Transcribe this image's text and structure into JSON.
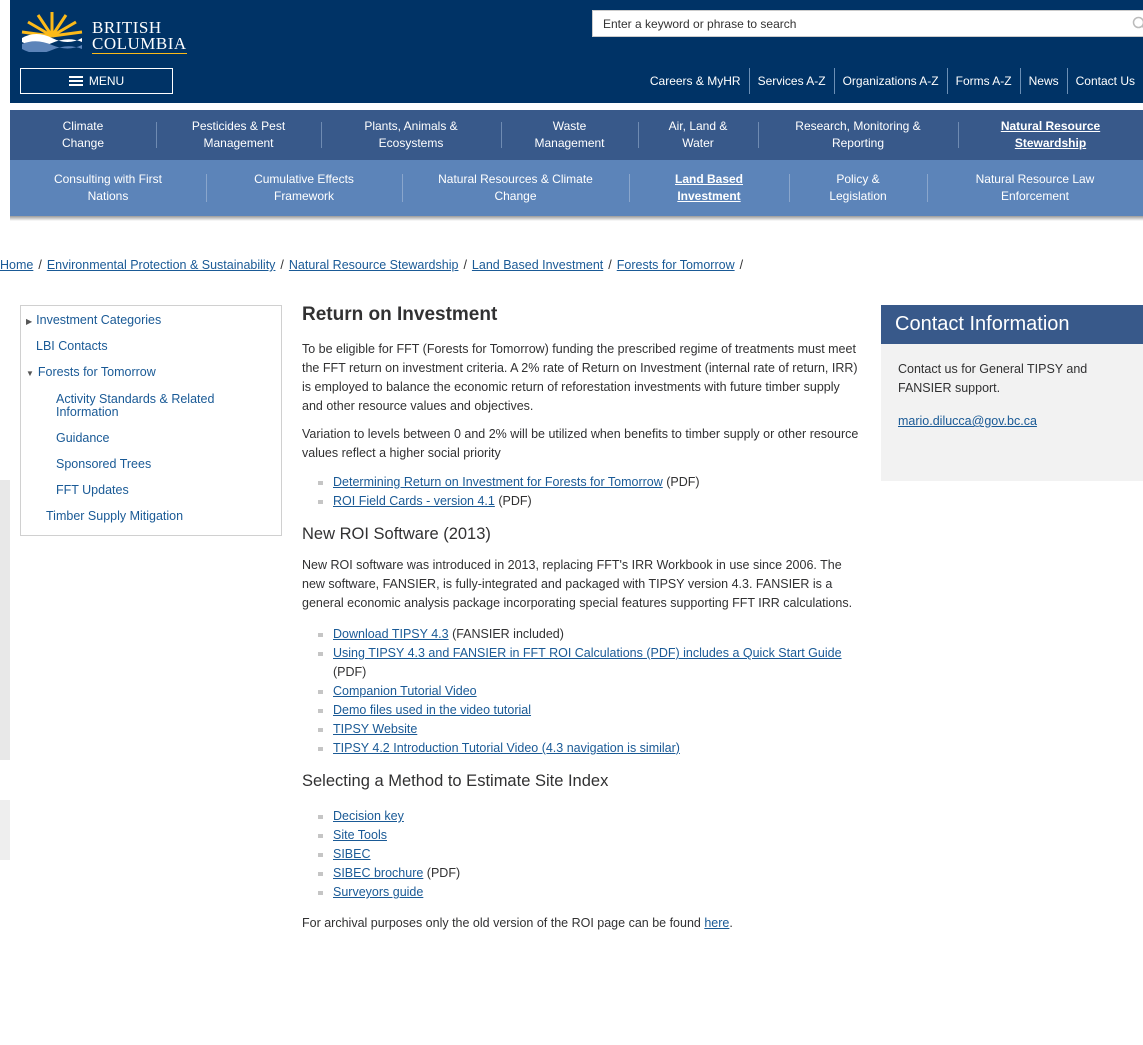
{
  "header": {
    "logo_line1": "BRITISH",
    "logo_line2": "COLUMBIA",
    "search_placeholder": "Enter a keyword or phrase to search",
    "menu_label": "MENU",
    "top_links": [
      "Careers & MyHR",
      "Services A-Z",
      "Organizations A-Z",
      "Forms A-Z",
      "News",
      "Contact Us"
    ]
  },
  "nav_primary": [
    {
      "l1": "Climate",
      "l2": "Change"
    },
    {
      "l1": "Pesticides & Pest",
      "l2": "Management"
    },
    {
      "l1": "Plants, Animals &",
      "l2": "Ecosystems"
    },
    {
      "l1": "Waste",
      "l2": "Management"
    },
    {
      "l1": "Air, Land &",
      "l2": "Water"
    },
    {
      "l1": "Research, Monitoring &",
      "l2": "Reporting"
    },
    {
      "l1": "Natural Resource",
      "l2": "Stewardship"
    }
  ],
  "nav_secondary": [
    {
      "l1": "Consulting with First",
      "l2": "Nations"
    },
    {
      "l1": "Cumulative Effects",
      "l2": "Framework"
    },
    {
      "l1": "Natural Resources & Climate",
      "l2": "Change"
    },
    {
      "l1": "Land Based",
      "l2": "Investment"
    },
    {
      "l1": "Policy &",
      "l2": "Legislation"
    },
    {
      "l1": "Natural Resource Law",
      "l2": "Enforcement"
    }
  ],
  "breadcrumb": [
    "Home",
    "Environmental Protection & Sustainability",
    "Natural Resource Stewardship",
    "Land Based Investment",
    "Forests for Tomorrow"
  ],
  "left_nav": {
    "investment_categories": "Investment Categories",
    "lbi_contacts": "LBI Contacts",
    "forests_for_tomorrow": "Forests for Tomorrow",
    "activity_standards_l1": "Activity Standards & Related",
    "activity_standards_l2": "Information",
    "guidance": "Guidance",
    "sponsored_trees": "Sponsored Trees",
    "fft_updates": "FFT Updates",
    "timber_supply": "Timber Supply Mitigation"
  },
  "main": {
    "title": "Return on Investment",
    "intro": "To be eligible for FFT (Forests for Tomorrow) funding the prescribed regime of treatments must meet the FFT return on investment criteria. A 2% rate of Return on Investment (internal rate of return, IRR) is employed to balance the economic return of reforestation investments with future timber supply and other resource values and objectives.",
    "variation": "Variation to levels between 0 and 2% will be utilized when benefits to timber supply or other resource values reflect a higher social priority",
    "roi_links": [
      {
        "text": "Determining Return on Investment for Forests for Tomorrow",
        "suffix": " (PDF)"
      },
      {
        "text": "ROI Field Cards - version 4.1",
        "suffix": " (PDF)"
      }
    ],
    "software_heading": "New ROI Software (2013)",
    "software_text": "New ROI software was introduced in 2013, replacing FFT's IRR Workbook in use since 2006. The new software, FANSIER, is fully-integrated and packaged with TIPSY version 4.3. FANSIER is a general economic analysis package incorporating special features supporting FFT IRR calculations.",
    "software_links": [
      {
        "text": "Download TIPSY 4.3",
        "suffix": " (FANSIER included)"
      },
      {
        "text": "Using TIPSY 4.3 and FANSIER in FFT ROI Calculations (PDF) includes a Quick Start Guide",
        "suffix": " (PDF)"
      },
      {
        "text": "Companion Tutorial Video",
        "suffix": ""
      },
      {
        "text": "Demo files used in the video tutorial",
        "suffix": ""
      },
      {
        "text": "TIPSY Website",
        "suffix": ""
      },
      {
        "text": "TIPSY 4.2 Introduction Tutorial Video (4.3 navigation is similar)",
        "suffix": ""
      }
    ],
    "site_heading": "Selecting a Method to Estimate Site Index",
    "site_links": [
      {
        "text": "Decision key",
        "suffix": ""
      },
      {
        "text": "Site Tools",
        "suffix": ""
      },
      {
        "text": "SIBEC",
        "suffix": ""
      },
      {
        "text": "SIBEC brochure",
        "suffix": " (PDF)"
      },
      {
        "text": "Surveyors guide",
        "suffix": ""
      }
    ],
    "archive_prefix": "For archival purposes only the old version of the ROI page can be found ",
    "archive_link": "here",
    "archive_suffix": "."
  },
  "contact": {
    "title": "Contact Information",
    "text": "Contact us for General TIPSY and FANSIER support.",
    "email": "mario.dilucca@gov.bc.ca"
  },
  "colors": {
    "header_bg": "#003366",
    "nav_primary_bg": "#38598a",
    "nav_secondary_bg": "#5c84b9",
    "link": "#1a5a96",
    "accent_gold": "#fcba19"
  },
  "icons": {
    "search": "search-icon",
    "menu": "hamburger-icon",
    "collapsed": "triangle-right-icon",
    "expanded": "triangle-down-icon"
  }
}
